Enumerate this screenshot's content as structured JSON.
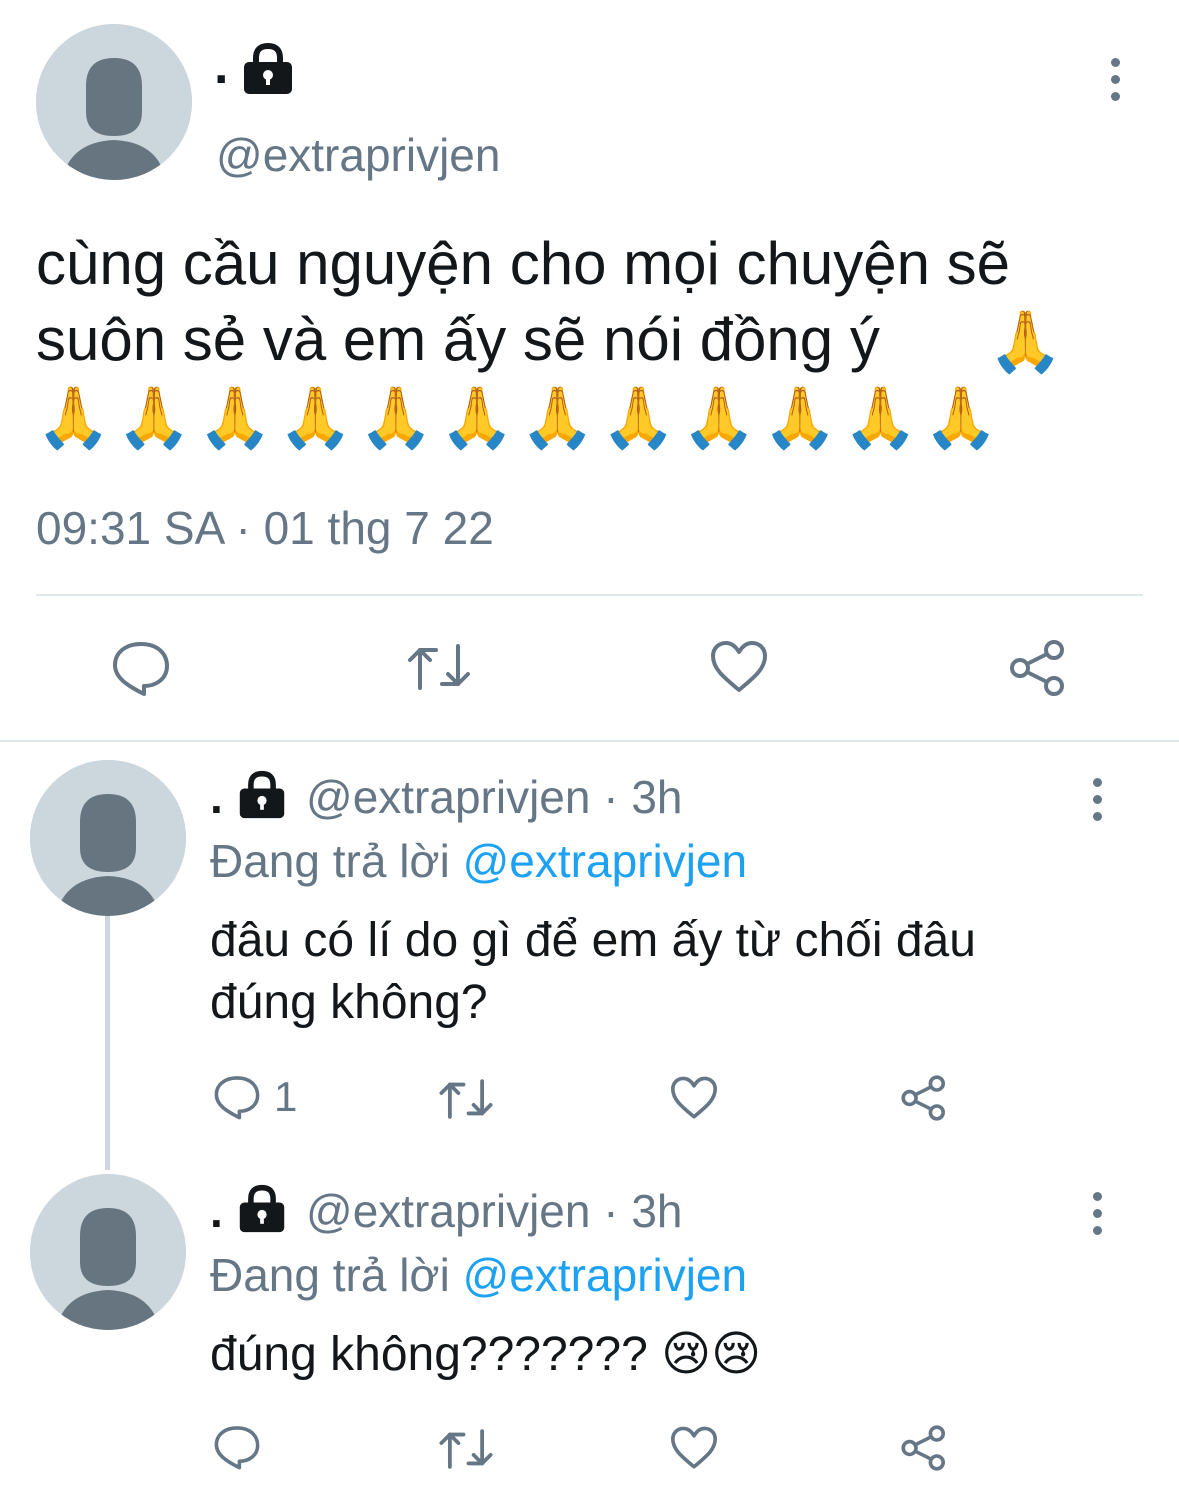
{
  "main_tweet": {
    "display_name": ".",
    "handle": "@extraprivjen",
    "text_line1": "cùng cầu nguyện cho mọi chuyện sẽ",
    "text_line2": "suôn sẻ và em ấy sẽ nói đồng ý",
    "emoji": "🙏",
    "timestamp": "09:31 SA · 01 thg 7 22",
    "icons": {
      "avatar": "default-avatar-icon",
      "lock": "lock-icon",
      "more": "more-vertical-icon"
    }
  },
  "replies": [
    {
      "display_name": ".",
      "handle": "@extraprivjen",
      "time": "· 3h",
      "replying_label": "Đang trả lời",
      "replying_to": "@extraprivjen",
      "text_line1": "đâu có lí do gì để em ấy từ chối đâu",
      "text_line2": "đúng không?",
      "reply_count": "1"
    },
    {
      "display_name": ".",
      "handle": "@extraprivjen",
      "time": "· 3h",
      "replying_label": "Đang trả lời",
      "replying_to": "@extraprivjen",
      "text": "đúng không???????",
      "emoji": "😢",
      "reply_count": ""
    }
  ],
  "colors": {
    "text": "#14171a",
    "muted": "#657786",
    "link": "#1da1f2",
    "avatar_bg": "#ccd6dd",
    "avatar_fg": "#66757f",
    "divider": "#e1e8ed"
  }
}
